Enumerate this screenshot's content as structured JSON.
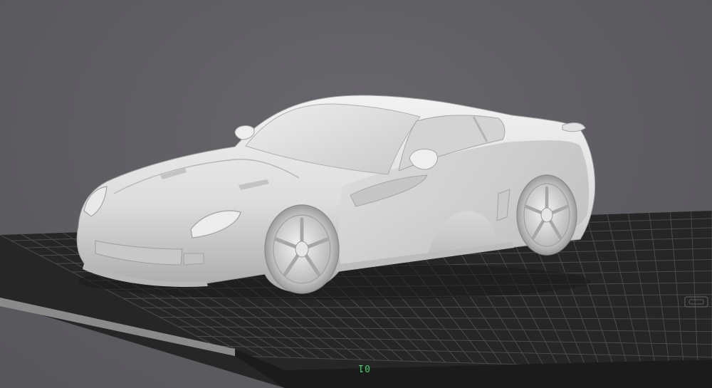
{
  "viewport": {
    "background_color": "#5f5e63",
    "bed_color": "#262626",
    "grid_color": "#4a4a4a",
    "model_color": "#e2e2e2"
  },
  "build_plate": {
    "label": "01",
    "label_color": "#3bd66a",
    "corner_icon": "bed-logo-icon"
  },
  "model": {
    "icon": "sports-car-model"
  }
}
